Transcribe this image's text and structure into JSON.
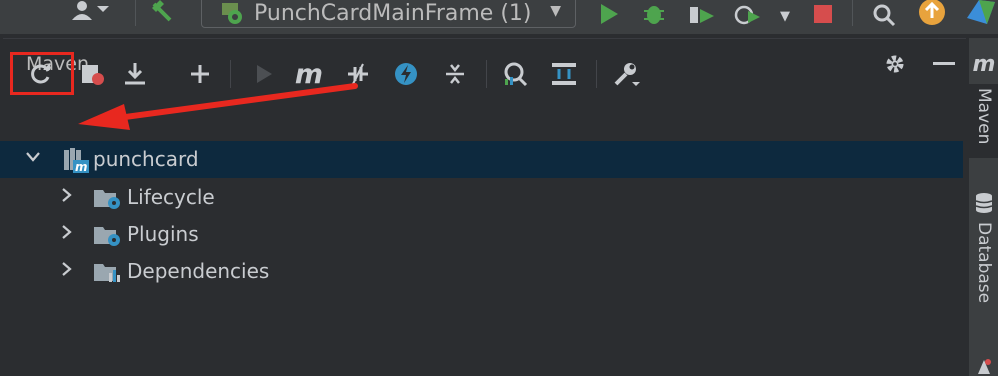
{
  "topbar": {
    "run_config_label": "PunchCardMainFrame (1)",
    "accent_green": "#4ea44e",
    "stop_red": "#d64d4d",
    "update_orange": "#e8a33d"
  },
  "tool_window": {
    "title": "Maven",
    "settings_icon": "gear-icon",
    "minimize_icon": "minimize-icon"
  },
  "maven_toolbar": {
    "buttons": [
      "reload-all-icon",
      "generate-sources-icon",
      "download-icon",
      "add-icon",
      "run-icon",
      "execute-goal-icon",
      "toggle-offline-icon",
      "skip-tests-icon",
      "collapse-all-icon",
      "analyze-dependencies-icon",
      "show-diagram-icon",
      "settings-wrench-icon"
    ],
    "execute_goal_glyph": "m",
    "highlight_color": "#e8281f"
  },
  "tree": {
    "root": {
      "label": "punchcard",
      "icon": "maven-module-icon"
    },
    "children": [
      {
        "label": "Lifecycle",
        "icon": "lifecycle-folder-icon"
      },
      {
        "label": "Plugins",
        "icon": "plugins-folder-icon"
      },
      {
        "label": "Dependencies",
        "icon": "dependencies-folder-icon"
      }
    ],
    "selected_color": "#0d293e"
  },
  "right_stripe": {
    "maven_tab": "Maven",
    "maven_glyph": "m",
    "database_tab": "Database"
  }
}
